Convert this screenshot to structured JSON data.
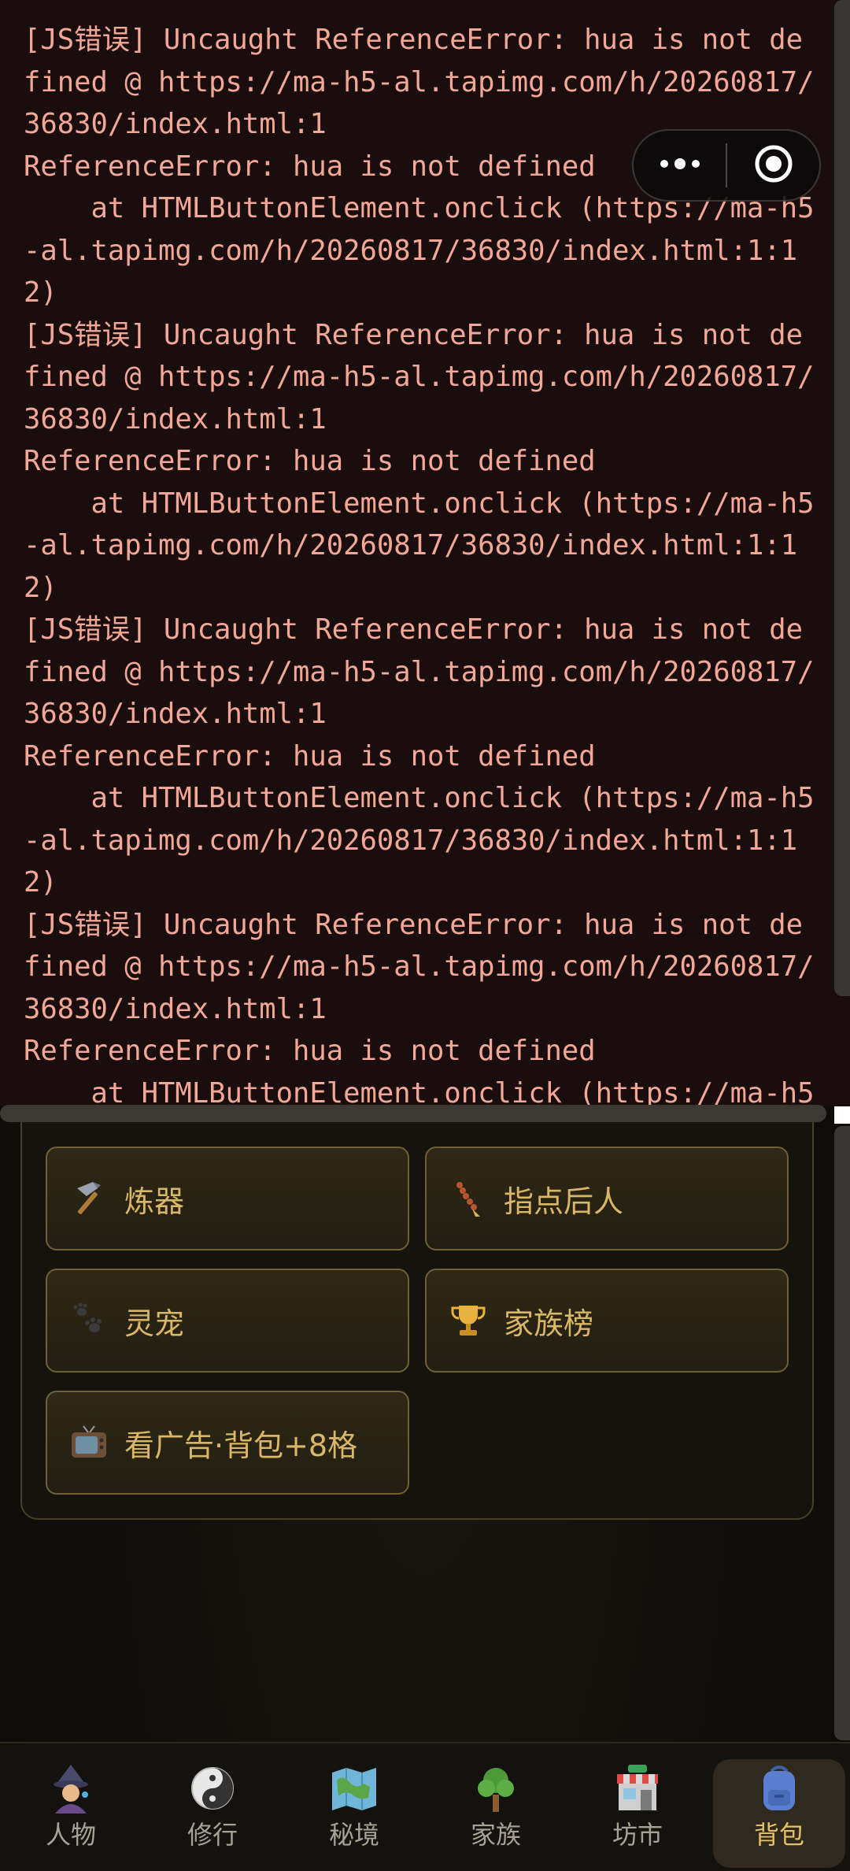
{
  "console": {
    "log": "[JS错误] Uncaught ReferenceError: hua is not defined @ https://ma-h5-al.tapimg.com/h/20260817/36830/index.html:1\nReferenceError: hua is not defined\n    at HTMLButtonElement.onclick (https://ma-h5-al.tapimg.com/h/20260817/36830/index.html:1:12)\n[JS错误] Uncaught ReferenceError: hua is not defined @ https://ma-h5-al.tapimg.com/h/20260817/36830/index.html:1\nReferenceError: hua is not defined\n    at HTMLButtonElement.onclick (https://ma-h5-al.tapimg.com/h/20260817/36830/index.html:1:12)\n[JS错误] Uncaught ReferenceError: hua is not defined @ https://ma-h5-al.tapimg.com/h/20260817/36830/index.html:1\nReferenceError: hua is not defined\n    at HTMLButtonElement.onclick (https://ma-h5-al.tapimg.com/h/20260817/36830/index.html:1:12)\n[JS错误] Uncaught ReferenceError: hua is not defined @ https://ma-h5-al.tapimg.com/h/20260817/36830/index.html:1\nReferenceError: hua is not defined\n    at HTMLButtonElement.onclick (https://ma-h5-"
  },
  "panel": {
    "buttons": [
      {
        "label": "炼器",
        "icon": "hammer-icon"
      },
      {
        "label": "指点后人",
        "icon": "prayer-beads-icon"
      },
      {
        "label": "灵宠",
        "icon": "paw-prints-icon"
      },
      {
        "label": "家族榜",
        "icon": "trophy-icon"
      },
      {
        "label": "看广告·背包+8格",
        "icon": "television-icon"
      }
    ]
  },
  "capsule": {
    "more_icon": "more-dots-icon",
    "close_icon": "target-close-icon"
  },
  "tabbar": {
    "tabs": [
      {
        "label": "人物",
        "icon": "mage-icon",
        "active": false
      },
      {
        "label": "修行",
        "icon": "yin-yang-icon",
        "active": false
      },
      {
        "label": "秘境",
        "icon": "map-icon",
        "active": false
      },
      {
        "label": "家族",
        "icon": "tree-icon",
        "active": false
      },
      {
        "label": "坊市",
        "icon": "store-icon",
        "active": false
      },
      {
        "label": "背包",
        "icon": "backpack-icon",
        "active": true
      }
    ]
  },
  "colors": {
    "console_bg": "#1a0d0e",
    "console_text": "#f3a796",
    "button_text": "#d9b766",
    "button_border": "#6e5f35",
    "tab_active_text": "#e6c165",
    "tab_text": "#a8a196"
  }
}
